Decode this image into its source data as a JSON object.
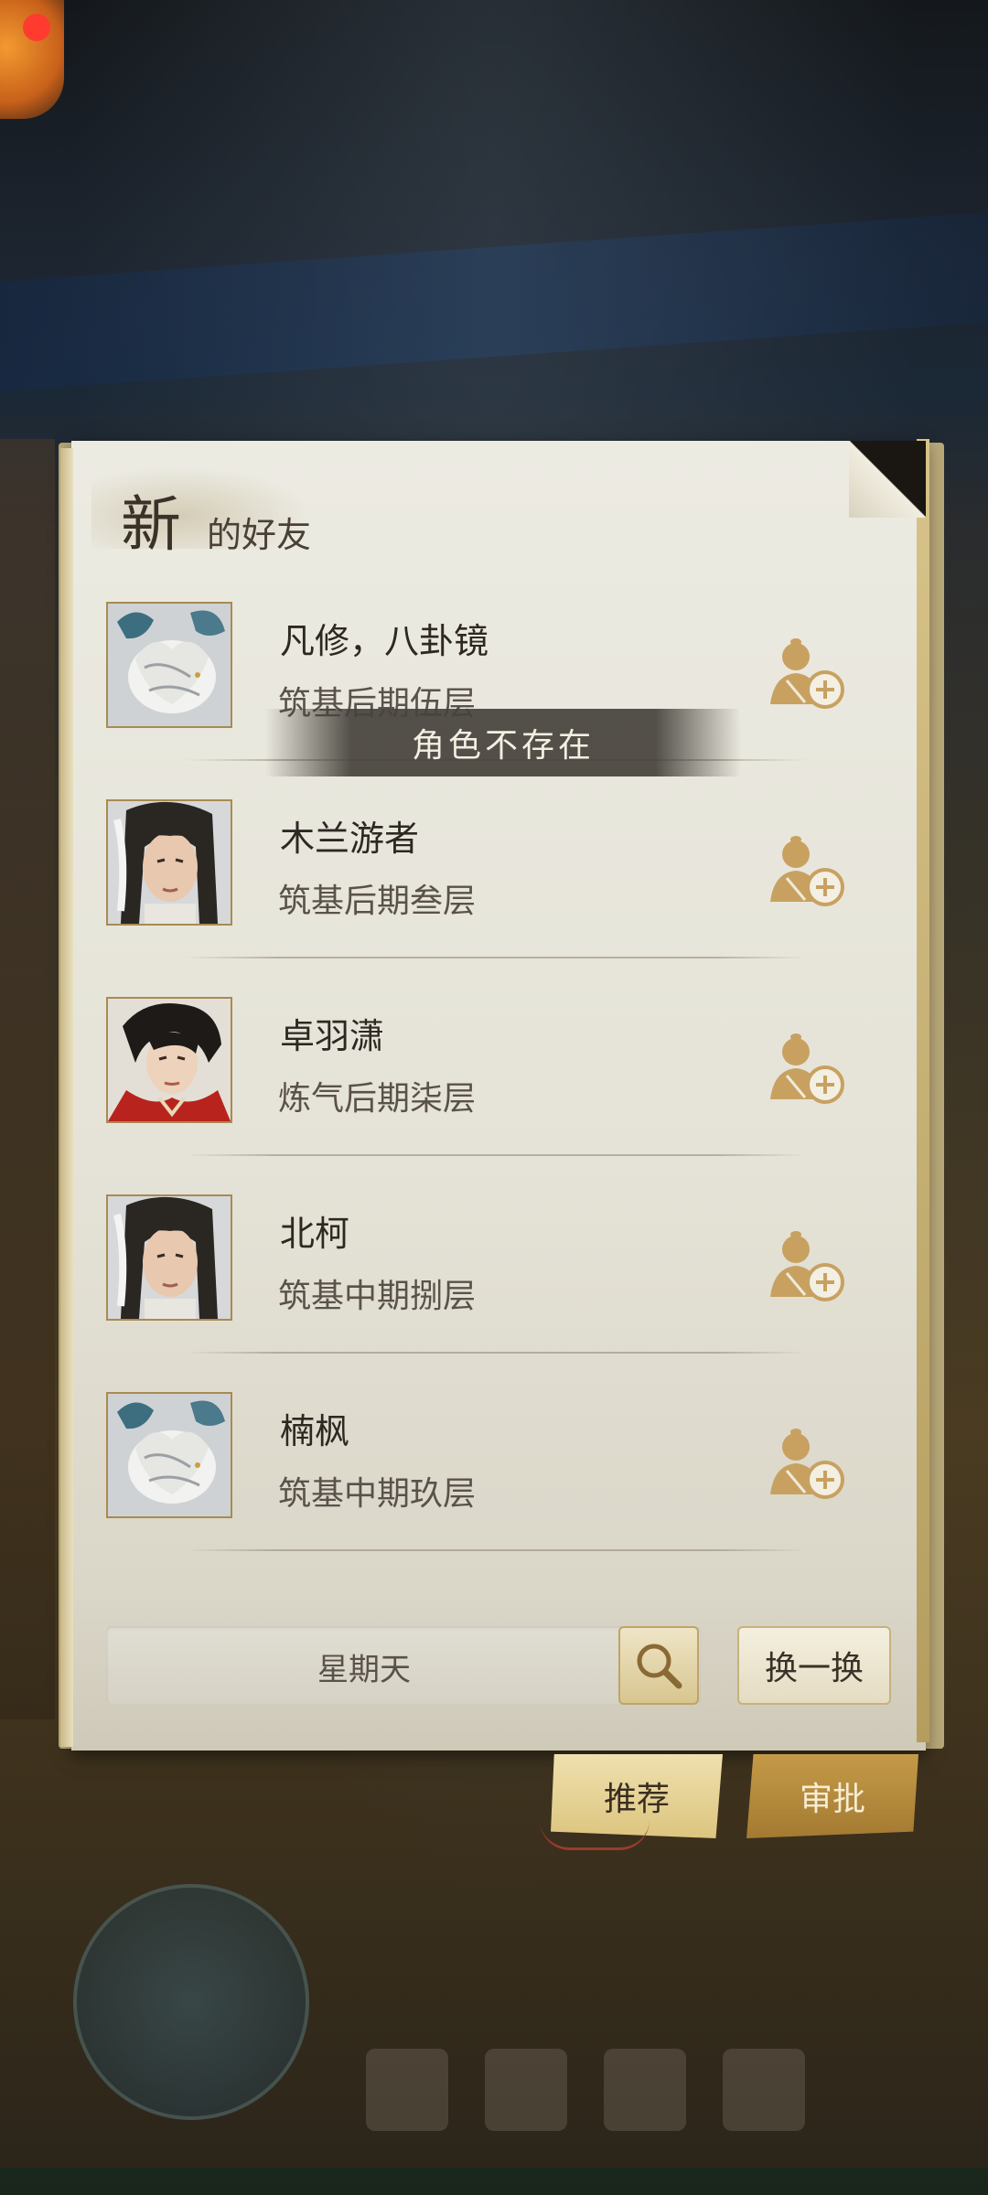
{
  "panel": {
    "title_big": "新",
    "title_small": "的好友"
  },
  "friends": [
    {
      "name": "凡修，八卦镜",
      "level": "筑基后期伍层",
      "avatar": "white-beast-avatar"
    },
    {
      "name": "木兰游者",
      "level": "筑基后期叁层",
      "avatar": "male-cultivator-avatar"
    },
    {
      "name": "卓羽潇",
      "level": "炼气后期柒层",
      "avatar": "red-robe-cultivator-avatar"
    },
    {
      "name": "北柯",
      "level": "筑基中期捌层",
      "avatar": "male-cultivator-avatar"
    },
    {
      "name": "楠枫",
      "level": "筑基中期玖层",
      "avatar": "white-beast-avatar"
    }
  ],
  "toast": "角色不存在",
  "search": {
    "value": "星期天"
  },
  "buttons": {
    "refresh": "换一换"
  },
  "tabs": {
    "recommend": "推荐",
    "approve": "审批"
  },
  "colors": {
    "paper": "#e5e3d7",
    "gold": "#c8a161",
    "text_dark": "#2e2822",
    "toast_bg": "#46423c"
  },
  "icons": {
    "add_friend": "add-friend-icon",
    "search": "magnifier-icon"
  }
}
